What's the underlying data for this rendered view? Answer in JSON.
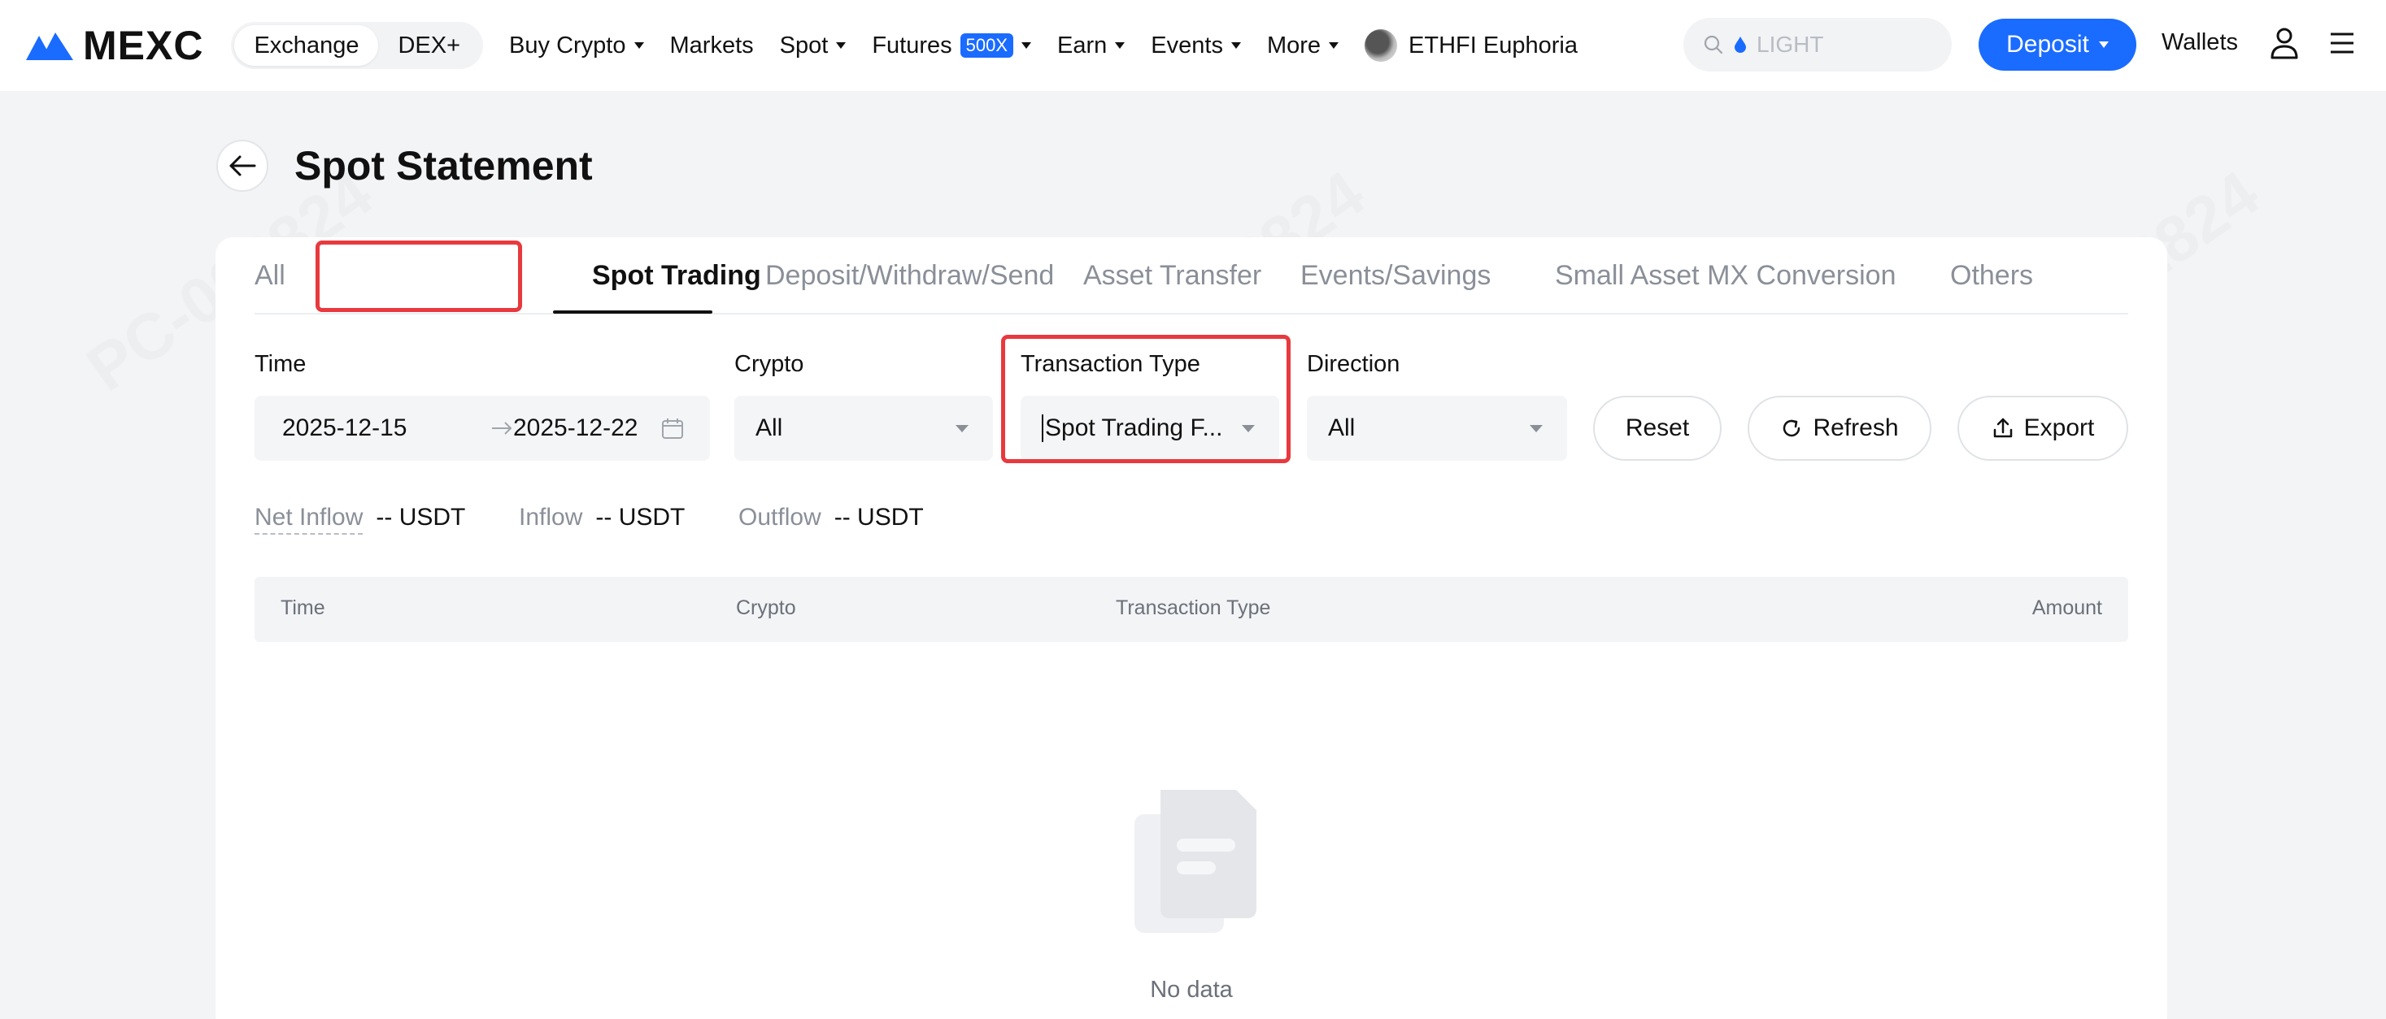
{
  "nav": {
    "brand": "MEXC",
    "toggle": [
      {
        "label": "Exchange",
        "active": true
      },
      {
        "label": "DEX+",
        "active": false
      }
    ],
    "items": [
      {
        "label": "Buy Crypto",
        "dropdown": true
      },
      {
        "label": "Markets",
        "dropdown": false
      },
      {
        "label": "Spot",
        "dropdown": true
      },
      {
        "label": "Futures",
        "badge": "500X",
        "dropdown": true
      },
      {
        "label": "Earn",
        "dropdown": true
      },
      {
        "label": "Events",
        "dropdown": true
      },
      {
        "label": "More",
        "dropdown": true
      }
    ],
    "promo": "ETHFI Euphoria",
    "search_placeholder": "LIGHT",
    "deposit_label": "Deposit",
    "wallets_label": "Wallets",
    "accent": "#1a6bff"
  },
  "page": {
    "title": "Spot Statement"
  },
  "tabs": [
    "All",
    "Spot Trading",
    "Deposit/Withdraw/Send",
    "Asset Transfer",
    "Events/Savings",
    "Small Asset MX Conversion",
    "Others"
  ],
  "active_tab": "Spot Trading",
  "filters": {
    "time_label": "Time",
    "start_date": "2025-12-15",
    "end_date": "2025-12-22",
    "crypto_label": "Crypto",
    "crypto_value": "All",
    "type_label": "Transaction Type",
    "type_value": "Spot Trading F...",
    "direction_label": "Direction",
    "direction_value": "All",
    "reset_label": "Reset",
    "refresh_label": "Refresh",
    "export_label": "Export"
  },
  "summary": {
    "net_inflow_label": "Net Inflow",
    "net_inflow_value": "-- USDT",
    "inflow_label": "Inflow",
    "inflow_value": "-- USDT",
    "outflow_label": "Outflow",
    "outflow_value": "-- USDT"
  },
  "table": {
    "columns": [
      "Time",
      "Crypto",
      "Transaction Type",
      "Amount"
    ],
    "empty_text": "No data"
  },
  "watermark": "PC-002824"
}
